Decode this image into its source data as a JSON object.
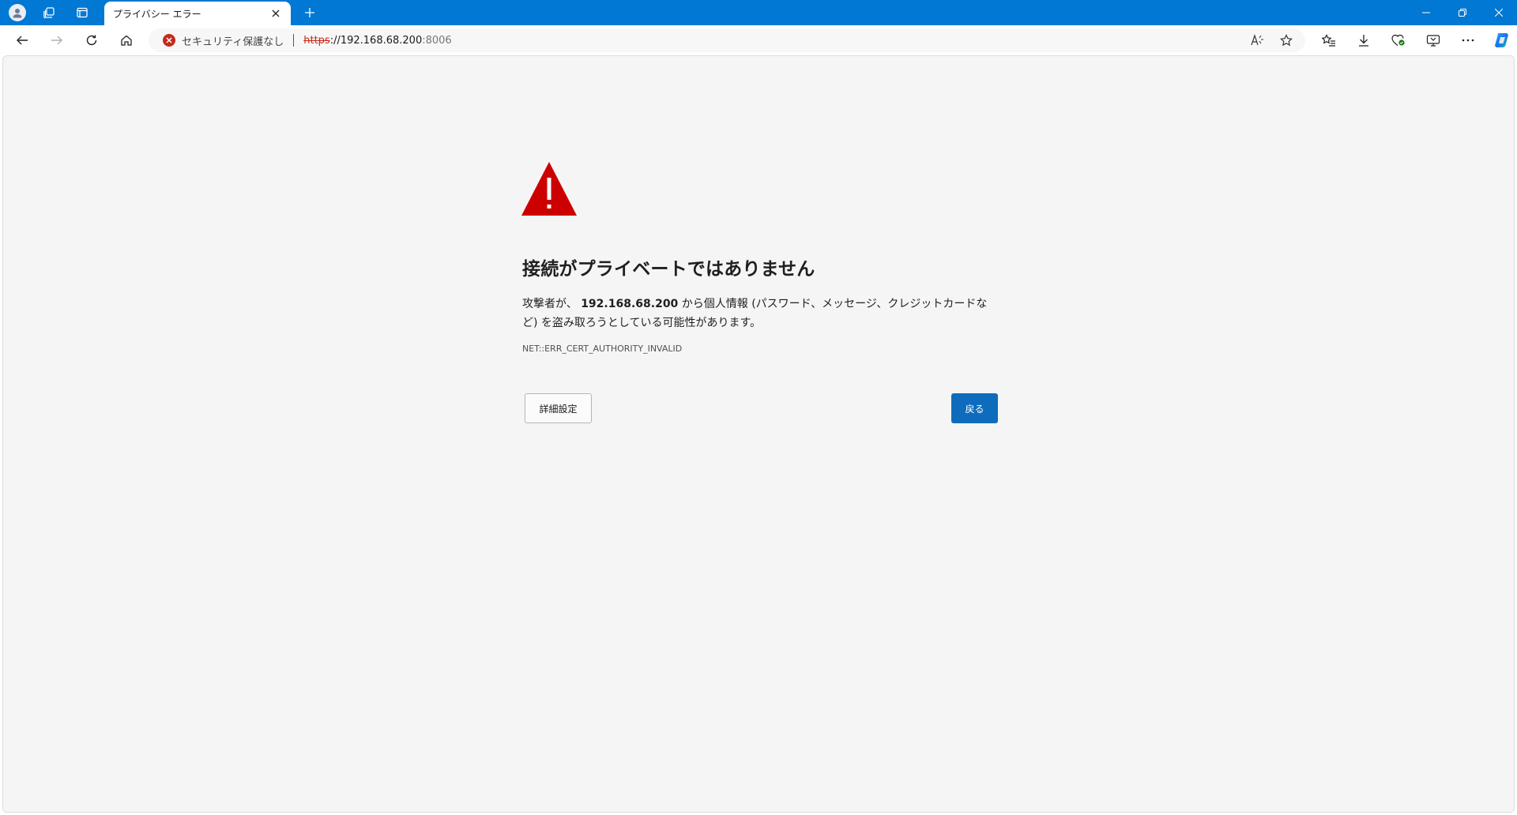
{
  "browser": {
    "accent_color": "#0078d4",
    "tab": {
      "title": "プライバシー エラー",
      "close_icon": "close-icon"
    },
    "new_tab_icon": "plus-icon",
    "window_controls": [
      "minimize-icon",
      "restore-icon",
      "close-icon"
    ],
    "nav": {
      "back": "back-arrow-icon",
      "forward": "forward-arrow-icon",
      "refresh": "refresh-icon",
      "home": "home-icon"
    },
    "address": {
      "security_label": "セキュリティ保護なし",
      "scheme": "https",
      "host": "://192.168.68.200",
      "port": ":8006",
      "security_color": "#c42b1c"
    },
    "address_actions": [
      "read-aloud-icon",
      "favorite-star-icon"
    ],
    "toolbar_actions": [
      "favorites-icon",
      "download-icon",
      "browser-essentials-icon",
      "screenshot-icon",
      "more-icon",
      "copilot-icon"
    ]
  },
  "page": {
    "headline": "接続がプライベートではありません",
    "desc_prefix": "攻撃者が、",
    "desc_host": "192.168.68.200",
    "desc_suffix": " から個人情報 (パスワード、メッセージ、クレジットカードなど) を盗み取ろうとしている可能性があります。",
    "error_code": "NET::ERR_CERT_AUTHORITY_INVALID",
    "advanced_button": "詳細設定",
    "back_button": "戻る",
    "warning_color": "#c50f1f",
    "primary_button_color": "#0f6cbd"
  }
}
